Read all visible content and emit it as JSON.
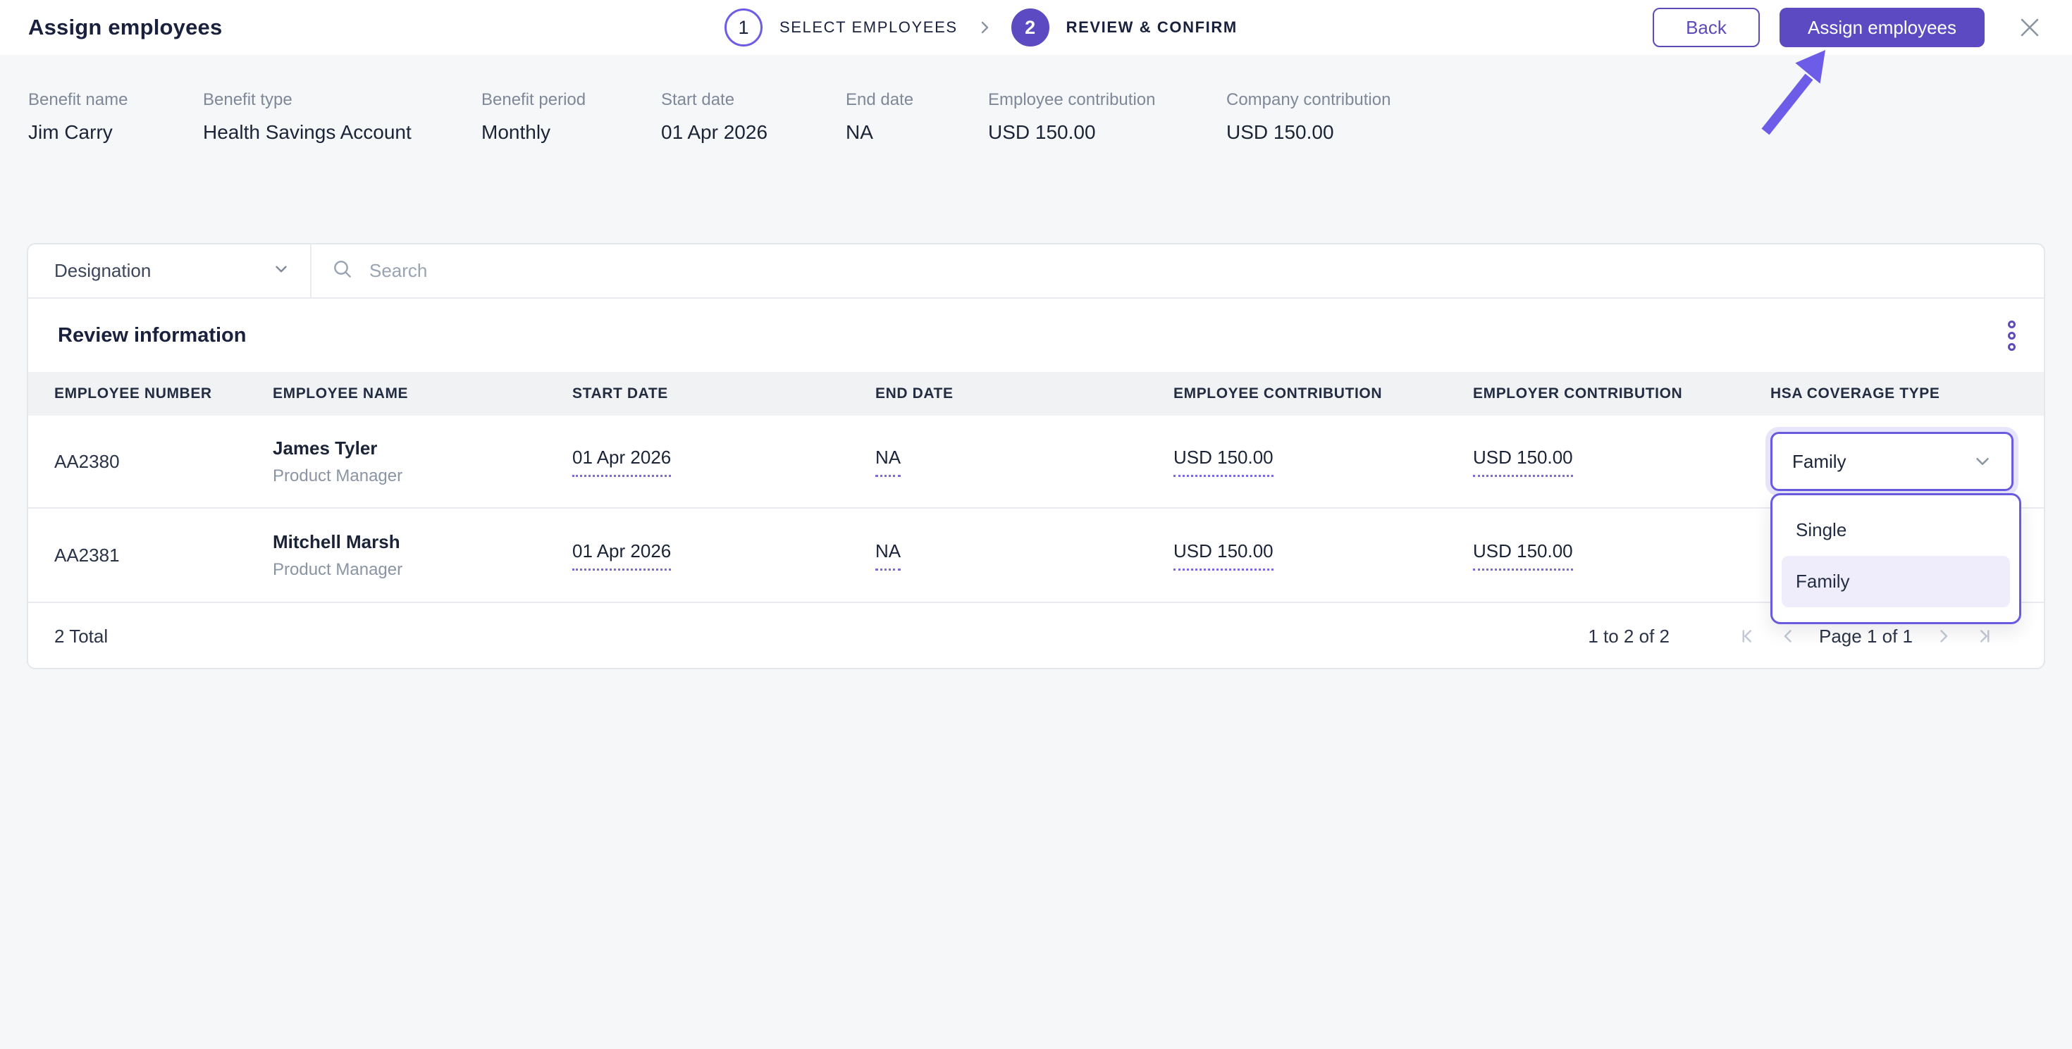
{
  "header": {
    "title": "Assign employees",
    "stepper": {
      "step1_number": "1",
      "step1_label": "SELECT EMPLOYEES",
      "step2_number": "2",
      "step2_label": "REVIEW & CONFIRM"
    },
    "back_label": "Back",
    "assign_label": "Assign employees"
  },
  "summary": {
    "items": [
      {
        "label": "Benefit name",
        "value": "Jim Carry"
      },
      {
        "label": "Benefit type",
        "value": "Health Savings Account"
      },
      {
        "label": "Benefit period",
        "value": "Monthly"
      },
      {
        "label": "Start date",
        "value": "01 Apr 2026"
      },
      {
        "label": "End date",
        "value": "NA"
      },
      {
        "label": "Employee contribution",
        "value": "USD 150.00"
      },
      {
        "label": "Company contribution",
        "value": "USD 150.00"
      }
    ]
  },
  "filters": {
    "designation_label": "Designation",
    "search_placeholder": "Search"
  },
  "table": {
    "section_title": "Review information",
    "columns": [
      "EMPLOYEE NUMBER",
      "EMPLOYEE NAME",
      "START DATE",
      "END DATE",
      "EMPLOYEE CONTRIBUTION",
      "EMPLOYER CONTRIBUTION",
      "HSA COVERAGE TYPE"
    ],
    "rows": [
      {
        "employee_number": "AA2380",
        "employee_name": "James Tyler",
        "designation": "Product Manager",
        "start_date": "01 Apr 2026",
        "end_date": "NA",
        "employee_contribution": "USD 150.00",
        "employer_contribution": "USD 150.00",
        "hsa_coverage_type": "Family"
      },
      {
        "employee_number": "AA2381",
        "employee_name": "Mitchell Marsh",
        "designation": "Product Manager",
        "start_date": "01 Apr 2026",
        "end_date": "NA",
        "employee_contribution": "USD 150.00",
        "employer_contribution": "USD 150.00",
        "hsa_coverage_type": ""
      }
    ],
    "footer": {
      "total": "2 Total",
      "range": "1 to 2 of 2",
      "page": "Page 1 of 1"
    }
  },
  "dropdown": {
    "options": [
      {
        "label": "Single"
      },
      {
        "label": "Family"
      }
    ]
  },
  "colors": {
    "primary_purple": "#5B4AC2",
    "outline_purple": "#6A5AE0",
    "arrow_purple": "#6C5CE7",
    "selected_option_bg": "#EFECFB",
    "page_bg": "#F6F7F9",
    "dark_text": "#1B2437",
    "muted_text": "#7E8899"
  }
}
